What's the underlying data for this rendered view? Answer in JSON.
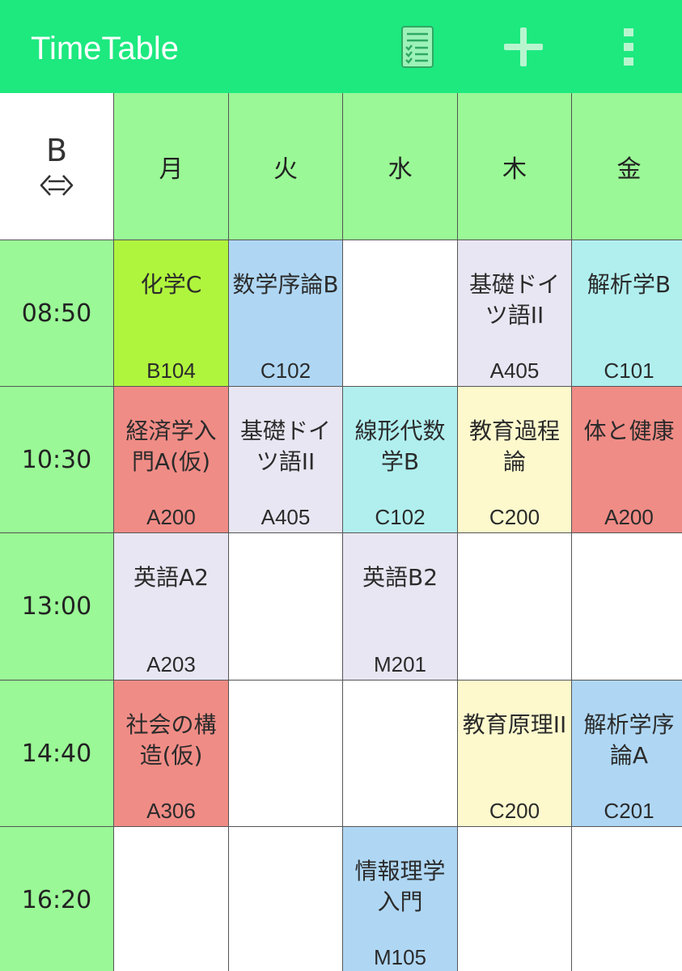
{
  "appbar": {
    "title": "TimeTable",
    "icons": [
      "checklist-icon",
      "plus-icon",
      "more-vert-icon"
    ],
    "color": "#1de97f"
  },
  "corner": {
    "week": "B",
    "swap": "⇔"
  },
  "days": [
    "月",
    "火",
    "水",
    "木",
    "金"
  ],
  "periods": [
    {
      "time": "08:50",
      "cells": [
        {
          "name": "化学C",
          "room": "B104",
          "color": "#b0f53d"
        },
        {
          "name": "数学序論B",
          "room": "C102",
          "color": "#afd7f4"
        },
        null,
        {
          "name": "基礎ドイツ語II",
          "room": "A405",
          "color": "#e8e6f2"
        },
        {
          "name": "解析学B",
          "room": "C101",
          "color": "#b1efef"
        }
      ]
    },
    {
      "time": "10:30",
      "cells": [
        {
          "name": "経済学入門A(仮)",
          "room": "A200",
          "color": "#f08c86"
        },
        {
          "name": "基礎ドイツ語II",
          "room": "A405",
          "color": "#e8e6f2"
        },
        {
          "name": "線形代数学B",
          "room": "C102",
          "color": "#b1efef"
        },
        {
          "name": "教育過程論",
          "room": "C200",
          "color": "#fdf9cd"
        },
        {
          "name": "体と健康",
          "room": "A200",
          "color": "#f08c86"
        }
      ]
    },
    {
      "time": "13:00",
      "cells": [
        {
          "name": "英語A2",
          "room": "A203",
          "color": "#e8e6f2"
        },
        null,
        {
          "name": "英語B2",
          "room": "M201",
          "color": "#e8e6f2"
        },
        null,
        null
      ]
    },
    {
      "time": "14:40",
      "cells": [
        {
          "name": "社会の構造(仮)",
          "room": "A306",
          "color": "#f08c86"
        },
        null,
        null,
        {
          "name": "教育原理II",
          "room": "C200",
          "color": "#fdf9cd"
        },
        {
          "name": "解析学序論A",
          "room": "C201",
          "color": "#afd7f4"
        }
      ]
    },
    {
      "time": "16:20",
      "cells": [
        null,
        null,
        {
          "name": "情報理学入門",
          "room": "M105",
          "color": "#afd7f4"
        },
        null,
        null
      ]
    }
  ]
}
